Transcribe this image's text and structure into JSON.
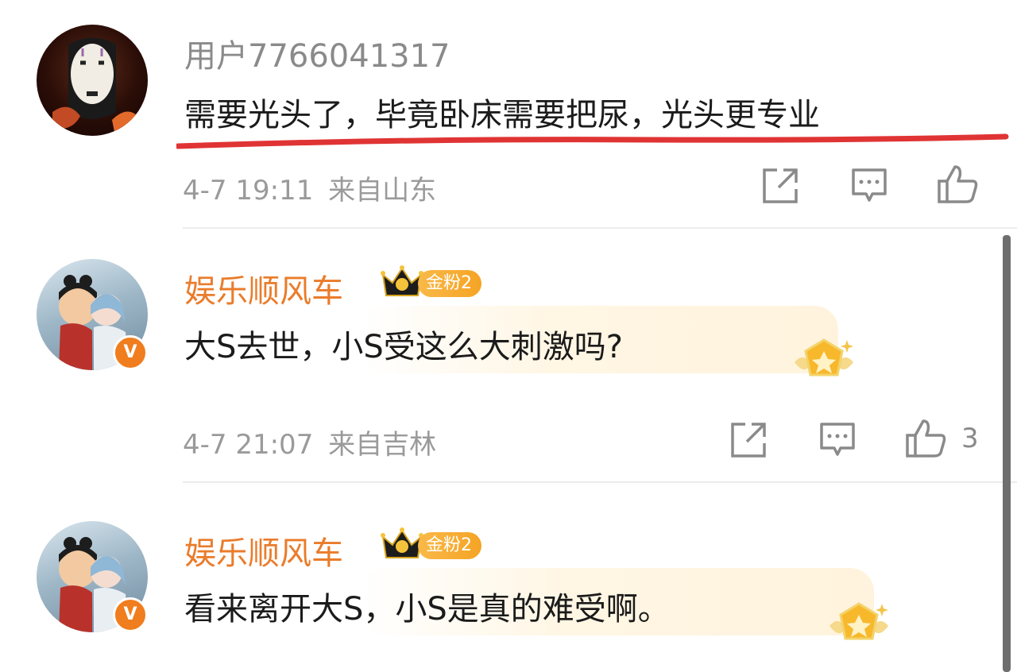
{
  "comments": [
    {
      "username": "用户7766041317",
      "text": "需要光头了，毕竟卧床需要把尿，光头更专业",
      "time": "4-7 19:11",
      "location": "来自山东",
      "likes": ""
    },
    {
      "username": "娱乐顺风车",
      "badge": "金粉2",
      "text": "大S去世，小S受这么大刺激吗?",
      "time": "4-7 21:07",
      "location": "来自吉林",
      "likes": "3"
    },
    {
      "username": "娱乐顺风车",
      "badge": "金粉2",
      "text": "看来离开大S，小S是真的难受啊。"
    }
  ],
  "icons": {
    "share": "share-icon",
    "comment": "comment-icon",
    "like": "thumbs-up-icon",
    "crown": "crown-icon",
    "verified": "verified-v-icon",
    "medal": "gold-medal-icon"
  },
  "colors": {
    "vip_name": "#ea7c2b",
    "underline": "#e03434",
    "badge_gold": "#f5a425",
    "verified": "#f07d1e"
  }
}
